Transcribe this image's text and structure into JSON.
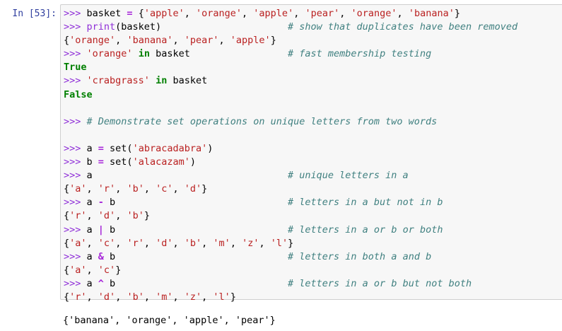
{
  "cell": {
    "prompt": "In [53]:",
    "lines": [
      [
        [
          "p",
          ">>> "
        ],
        [
          "t",
          "basket "
        ],
        [
          "op",
          "="
        ],
        [
          "t",
          " {"
        ],
        [
          "s",
          "'apple'"
        ],
        [
          "t",
          ", "
        ],
        [
          "s",
          "'orange'"
        ],
        [
          "t",
          ", "
        ],
        [
          "s",
          "'apple'"
        ],
        [
          "t",
          ", "
        ],
        [
          "s",
          "'pear'"
        ],
        [
          "t",
          ", "
        ],
        [
          "s",
          "'orange'"
        ],
        [
          "t",
          ", "
        ],
        [
          "s",
          "'banana'"
        ],
        [
          "t",
          "}"
        ]
      ],
      [
        [
          "p",
          ">>> "
        ],
        [
          "kw",
          "print"
        ],
        [
          "t",
          "(basket)                      "
        ],
        [
          "c",
          "# show that duplicates have been removed"
        ]
      ],
      [
        [
          "t",
          "{"
        ],
        [
          "s",
          "'orange'"
        ],
        [
          "t",
          ", "
        ],
        [
          "s",
          "'banana'"
        ],
        [
          "t",
          ", "
        ],
        [
          "s",
          "'pear'"
        ],
        [
          "t",
          ", "
        ],
        [
          "s",
          "'apple'"
        ],
        [
          "t",
          "}"
        ]
      ],
      [
        [
          "p",
          ">>> "
        ],
        [
          "s",
          "'orange'"
        ],
        [
          "t",
          " "
        ],
        [
          "kwb",
          "in"
        ],
        [
          "t",
          " basket                 "
        ],
        [
          "c",
          "# fast membership testing"
        ]
      ],
      [
        [
          "bool",
          "True"
        ]
      ],
      [
        [
          "p",
          ">>> "
        ],
        [
          "s",
          "'crabgrass'"
        ],
        [
          "t",
          " "
        ],
        [
          "kwb",
          "in"
        ],
        [
          "t",
          " basket"
        ]
      ],
      [
        [
          "bool",
          "False"
        ]
      ],
      [
        [
          "t",
          ""
        ]
      ],
      [
        [
          "p",
          ">>> "
        ],
        [
          "c",
          "# Demonstrate set operations on unique letters from two words"
        ]
      ],
      [
        [
          "t",
          ""
        ]
      ],
      [
        [
          "p",
          ">>> "
        ],
        [
          "t",
          "a "
        ],
        [
          "op",
          "="
        ],
        [
          "t",
          " set("
        ],
        [
          "s",
          "'abracadabra'"
        ],
        [
          "t",
          ")"
        ]
      ],
      [
        [
          "p",
          ">>> "
        ],
        [
          "t",
          "b "
        ],
        [
          "op",
          "="
        ],
        [
          "t",
          " set("
        ],
        [
          "s",
          "'alacazam'"
        ],
        [
          "t",
          ")"
        ]
      ],
      [
        [
          "p",
          ">>> "
        ],
        [
          "t",
          "a                                  "
        ],
        [
          "c",
          "# unique letters in a"
        ]
      ],
      [
        [
          "t",
          "{"
        ],
        [
          "s",
          "'a'"
        ],
        [
          "t",
          ", "
        ],
        [
          "s",
          "'r'"
        ],
        [
          "t",
          ", "
        ],
        [
          "s",
          "'b'"
        ],
        [
          "t",
          ", "
        ],
        [
          "s",
          "'c'"
        ],
        [
          "t",
          ", "
        ],
        [
          "s",
          "'d'"
        ],
        [
          "t",
          "}"
        ]
      ],
      [
        [
          "p",
          ">>> "
        ],
        [
          "t",
          "a "
        ],
        [
          "op",
          "-"
        ],
        [
          "t",
          " b                              "
        ],
        [
          "c",
          "# letters in a but not in b"
        ]
      ],
      [
        [
          "t",
          "{"
        ],
        [
          "s",
          "'r'"
        ],
        [
          "t",
          ", "
        ],
        [
          "s",
          "'d'"
        ],
        [
          "t",
          ", "
        ],
        [
          "s",
          "'b'"
        ],
        [
          "t",
          "}"
        ]
      ],
      [
        [
          "p",
          ">>> "
        ],
        [
          "t",
          "a "
        ],
        [
          "op",
          "|"
        ],
        [
          "t",
          " b                              "
        ],
        [
          "c",
          "# letters in a or b or both"
        ]
      ],
      [
        [
          "t",
          "{"
        ],
        [
          "s",
          "'a'"
        ],
        [
          "t",
          ", "
        ],
        [
          "s",
          "'c'"
        ],
        [
          "t",
          ", "
        ],
        [
          "s",
          "'r'"
        ],
        [
          "t",
          ", "
        ],
        [
          "s",
          "'d'"
        ],
        [
          "t",
          ", "
        ],
        [
          "s",
          "'b'"
        ],
        [
          "t",
          ", "
        ],
        [
          "s",
          "'m'"
        ],
        [
          "t",
          ", "
        ],
        [
          "s",
          "'z'"
        ],
        [
          "t",
          ", "
        ],
        [
          "s",
          "'l'"
        ],
        [
          "t",
          "}"
        ]
      ],
      [
        [
          "p",
          ">>> "
        ],
        [
          "t",
          "a "
        ],
        [
          "op",
          "&"
        ],
        [
          "t",
          " b                              "
        ],
        [
          "c",
          "# letters in both a and b"
        ]
      ],
      [
        [
          "t",
          "{"
        ],
        [
          "s",
          "'a'"
        ],
        [
          "t",
          ", "
        ],
        [
          "s",
          "'c'"
        ],
        [
          "t",
          "}"
        ]
      ],
      [
        [
          "p",
          ">>> "
        ],
        [
          "t",
          "a "
        ],
        [
          "op",
          "^"
        ],
        [
          "t",
          " b                              "
        ],
        [
          "c",
          "# letters in a or b but not both"
        ]
      ],
      [
        [
          "t",
          "{"
        ],
        [
          "s",
          "'r'"
        ],
        [
          "t",
          ", "
        ],
        [
          "s",
          "'d'"
        ],
        [
          "t",
          ", "
        ],
        [
          "s",
          "'b'"
        ],
        [
          "t",
          ", "
        ],
        [
          "s",
          "'m'"
        ],
        [
          "t",
          ", "
        ],
        [
          "s",
          "'z'"
        ],
        [
          "t",
          ", "
        ],
        [
          "s",
          "'l'"
        ],
        [
          "t",
          "}"
        ]
      ]
    ],
    "output": "{'banana', 'orange', 'apple', 'pear'}"
  },
  "colors": {
    "prompt": "#303f9f",
    "cell_background": "#f7f7f7",
    "cell_border": "#cfcfcf",
    "string": "#ba2121",
    "comment": "#408080",
    "keyword": "#008000",
    "repl_prompt": "#8f2fd8"
  }
}
